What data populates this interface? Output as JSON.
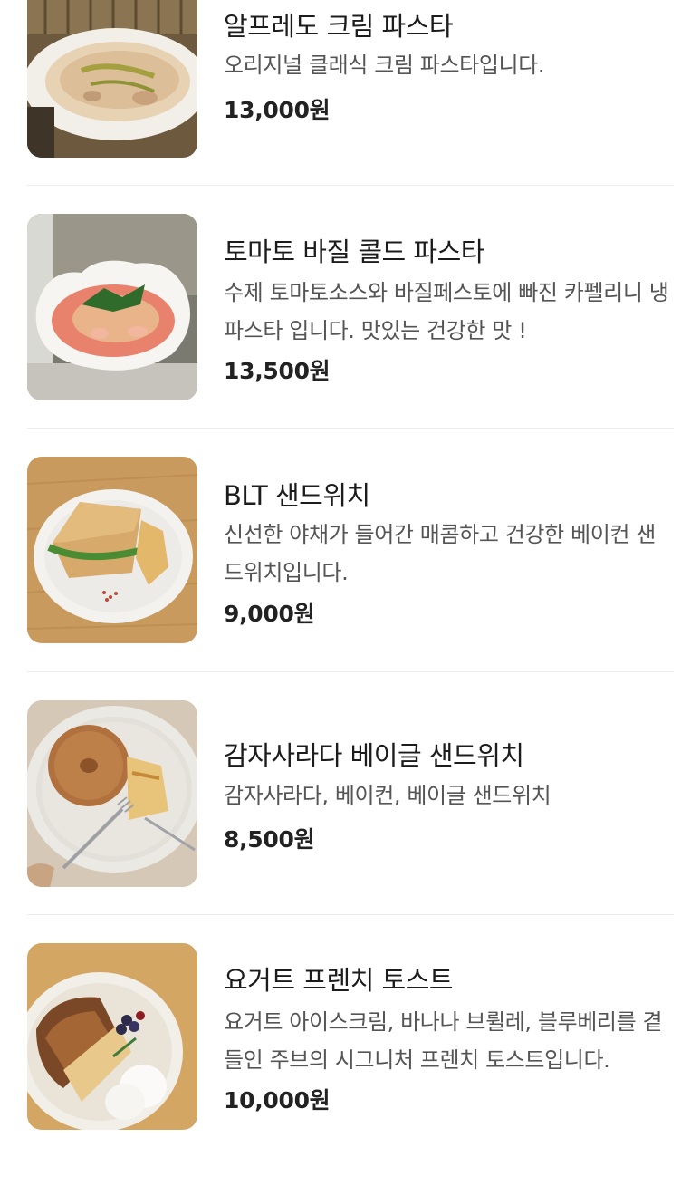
{
  "menu": {
    "items": [
      {
        "name": "알프레도 크림 파스타",
        "desc": "오리지널 클래식 크림 파스타입니다.",
        "price": "13,000원",
        "image": "cream-pasta-photo"
      },
      {
        "name": "토마토 바질 콜드 파스타",
        "desc": "수제 토마토소스와 바질페스토에 빠진 카펠리니 냉 파스타 입니다. 맛있는 건강한 맛 !",
        "price": "13,500원",
        "image": "tomato-basil-pasta-photo"
      },
      {
        "name": "BLT 샌드위치",
        "desc": "신선한 야채가 들어간 매콤하고 건강한 베이컨 샌드위치입니다.",
        "price": "9,000원",
        "image": "blt-sandwich-photo"
      },
      {
        "name": "감자사라다 베이글 샌드위치",
        "desc": "감자사라다, 베이컨, 베이글 샌드위치",
        "price": "8,500원",
        "image": "bagel-sandwich-photo"
      },
      {
        "name": "요거트 프렌치 토스트",
        "desc": "요거트 아이스크림, 바나나 브륄레, 블루베리를 곁들인 주브의 시그니처 프렌치 토스트입니다.",
        "price": "10,000원",
        "image": "french-toast-photo"
      }
    ]
  }
}
